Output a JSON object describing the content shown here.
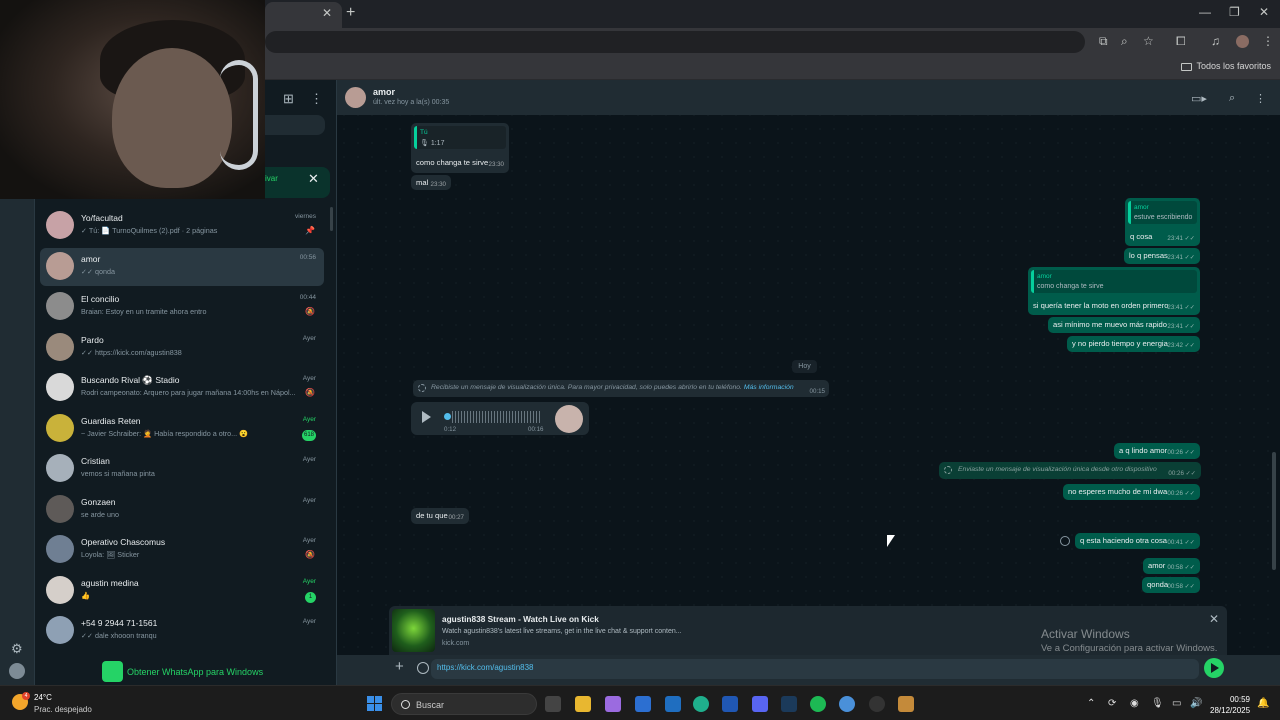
{
  "browser": {
    "favorites_label": "Todos los favoritos"
  },
  "sidebar_banner": {
    "action": "ivar"
  },
  "chat_list": [
    {
      "name": "Yo/facultad",
      "preview": "✓ Tú: 📄 TurnoQuilmes (2).pdf · 2 páginas",
      "time": "viernes",
      "flag": "📌",
      "avatar": "#c7a2a6"
    },
    {
      "name": "amor",
      "preview": "✓✓ qonda",
      "time": "00:56",
      "avatar": "#b89c94",
      "active": true
    },
    {
      "name": "El concilio",
      "preview": "Braian: Estoy en un tramite ahora entro",
      "time": "00:44",
      "flag": "🔕",
      "avatar": "#8c8c8c"
    },
    {
      "name": "Pardo",
      "preview": "✓✓ https://kick.com/agustin838",
      "time": "Ayer",
      "avatar": "#9a8a7c"
    },
    {
      "name": "Buscando Rival ⚽ Stadio",
      "preview": "Rodri campeonato: Arquero para jugar mañana 14:00hs en Nápol...",
      "time": "Ayer",
      "flag": "🔕",
      "avatar": "#d9d9d9"
    },
    {
      "name": "Guardias Reten",
      "preview": "~ Javier Schraiber: 🤦 Había respondido a otro... 😮",
      "time": "Ayer",
      "time_green": true,
      "badge": "618",
      "avatar": "#c9b23a"
    },
    {
      "name": "Cristian",
      "preview": "vemos si mañana pinta",
      "time": "Ayer",
      "avatar": "#a6b0ba"
    },
    {
      "name": "Gonzaen",
      "preview": "se arde uno",
      "time": "Ayer",
      "avatar": "#5e5a58"
    },
    {
      "name": "Operativo Chascomus",
      "preview": "Loyola: 🖼 Sticker",
      "time": "Ayer",
      "flag": "🔕",
      "avatar": "#6f7f93"
    },
    {
      "name": "agustin medina",
      "preview": "👍",
      "time": "Ayer",
      "time_green": true,
      "badge": "1",
      "avatar": "#d5cfca"
    },
    {
      "name": "+54 9 2944 71-1561",
      "preview": "✓✓ dale xhooon tranqu",
      "time": "Ayer",
      "avatar": "#8ea0b4"
    }
  ],
  "get_app_label": "Obtener WhatsApp para Windows",
  "conversation": {
    "name": "amor",
    "status": "últ. vez hoy a la(s) 00:35",
    "messages": {
      "m1_quote_author": "Tú",
      "m1_quote_text": "🎙 1:17",
      "m1_text": "como changa te sirve",
      "m1_time": "23:30",
      "m2_text": "mal",
      "m2_time": "23:30",
      "m3_quote_author": "amor",
      "m3_quote_text": "estuve escribiendo",
      "m3_text": "q cosa",
      "m3_time": "23:41 ✓✓",
      "m4_text": "lo q pensas",
      "m4_time": "23:41 ✓✓",
      "m5_quote_author": "amor",
      "m5_quote_text": "como changa te sirve",
      "m5_text": "si quería tener la moto en orden primero",
      "m5_time": "23:41 ✓✓",
      "m6_text": "asi mínimo me muevo más rapido",
      "m6_time": "23:41 ✓✓",
      "m7_text": "y no pierdo tiempo y energia",
      "m7_time": "23:42 ✓✓",
      "day": "Hoy",
      "sys1_text": "Recibiste un mensaje de visualización única. Para mayor privacidad, solo puedes abrirlo en tu teléfono.",
      "sys1_link": "Más información",
      "sys1_time": "00:15",
      "voice_elapsed": "0:12",
      "voice_time": "00:16",
      "m8_text": "a q lindo amor",
      "m8_time": "00:26 ✓✓",
      "sys2_text": "Enviaste un mensaje de visualización única desde otro dispositivo",
      "sys2_time": "00:26 ✓✓",
      "m9_text": "no esperes mucho de mi dwa",
      "m9_time": "00:26 ✓✓",
      "m10_text": "de tu que",
      "m10_time": "00:27",
      "m11_text": "q esta haciendo otra cosa",
      "m11_time": "00:41 ✓✓",
      "m12_text": "amor",
      "m12_time": "00:58 ✓✓",
      "m13_text": "qonda",
      "m13_time": "00:58 ✓✓"
    }
  },
  "link_preview": {
    "title": "agustin838 Stream - Watch Live on Kick",
    "description": "Watch agustin838's latest live streams, get in the live chat & support conten...",
    "domain": "kick.com"
  },
  "compose": {
    "value": "https://kick.com/agustin838"
  },
  "watermark": {
    "line1": "Activar Windows",
    "line2": "Ve a Configuración para activar Windows."
  },
  "taskbar": {
    "weather_temp": "24°C",
    "weather_desc": "Prac. despejado",
    "weather_badge": "4",
    "search": "Buscar",
    "time": "00:59",
    "date": "28/12/2025"
  },
  "colors": {
    "accent": "#25d366",
    "outgoing": "#005c4b",
    "incoming": "#202c33",
    "background": "#0b141a"
  }
}
